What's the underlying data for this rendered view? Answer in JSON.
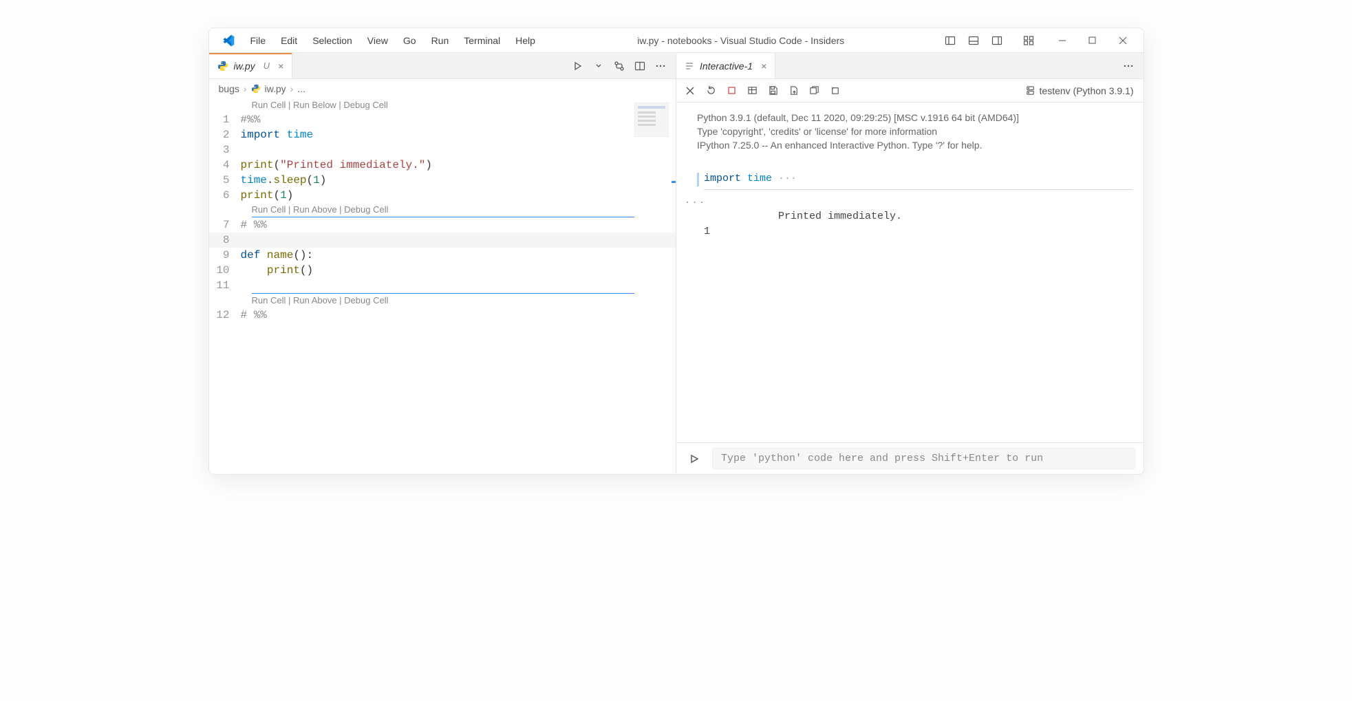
{
  "title": "iw.py - notebooks - Visual Studio Code - Insiders",
  "menu": [
    "File",
    "Edit",
    "Selection",
    "View",
    "Go",
    "Run",
    "Terminal",
    "Help"
  ],
  "left_tab": {
    "filename": "iw.py",
    "modified_marker": "U"
  },
  "breadcrumb": {
    "folder": "bugs",
    "file": "iw.py",
    "tail": "..."
  },
  "codelens": {
    "cell1": "Run Cell | Run Below | Debug Cell",
    "cell2": "Run Cell | Run Above | Debug Cell",
    "cell3": "Run Cell | Run Above | Debug Cell"
  },
  "lines": {
    "l1": "#%%",
    "l2_kw": "import",
    "l2_mod": "time",
    "l4_fn": "print",
    "l4_paren_open": "(",
    "l4_str": "\"Printed immediately.\"",
    "l4_paren_close": ")",
    "l5_obj": "time",
    "l5_dot": ".",
    "l5_m": "sleep",
    "l5_paren_open": "(",
    "l5_num": "1",
    "l5_paren_close": ")",
    "l6_fn": "print",
    "l6_paren_open": "(",
    "l6_num": "1",
    "l6_paren_close": ")",
    "l7": "# %%",
    "l9_def": "def",
    "l9_name": "name",
    "l9_sig": "():",
    "l10_indent": "    ",
    "l10_fn": "print",
    "l10_call": "()",
    "l12": "# %%"
  },
  "linenos": [
    "1",
    "2",
    "3",
    "4",
    "5",
    "6",
    "7",
    "8",
    "9",
    "10",
    "11",
    "12"
  ],
  "right_tab": {
    "name": "Interactive-1"
  },
  "kernel": "testenv (Python 3.9.1)",
  "banner": {
    "l1": "Python 3.9.1 (default, Dec 11 2020, 09:29:25) [MSC v.1916 64 bit (AMD64)]",
    "l2": "Type 'copyright', 'credits' or 'license' for more information",
    "l3": "IPython 7.25.0 -- An enhanced Interactive Python. Type '?' for help."
  },
  "io": {
    "code_kw": "import",
    "code_mod": "time",
    "code_ellipsis": " ···",
    "out_line1": "Printed immediately.",
    "out_line2": "1"
  },
  "input_placeholder": "Type 'python' code here and press Shift+Enter to run"
}
